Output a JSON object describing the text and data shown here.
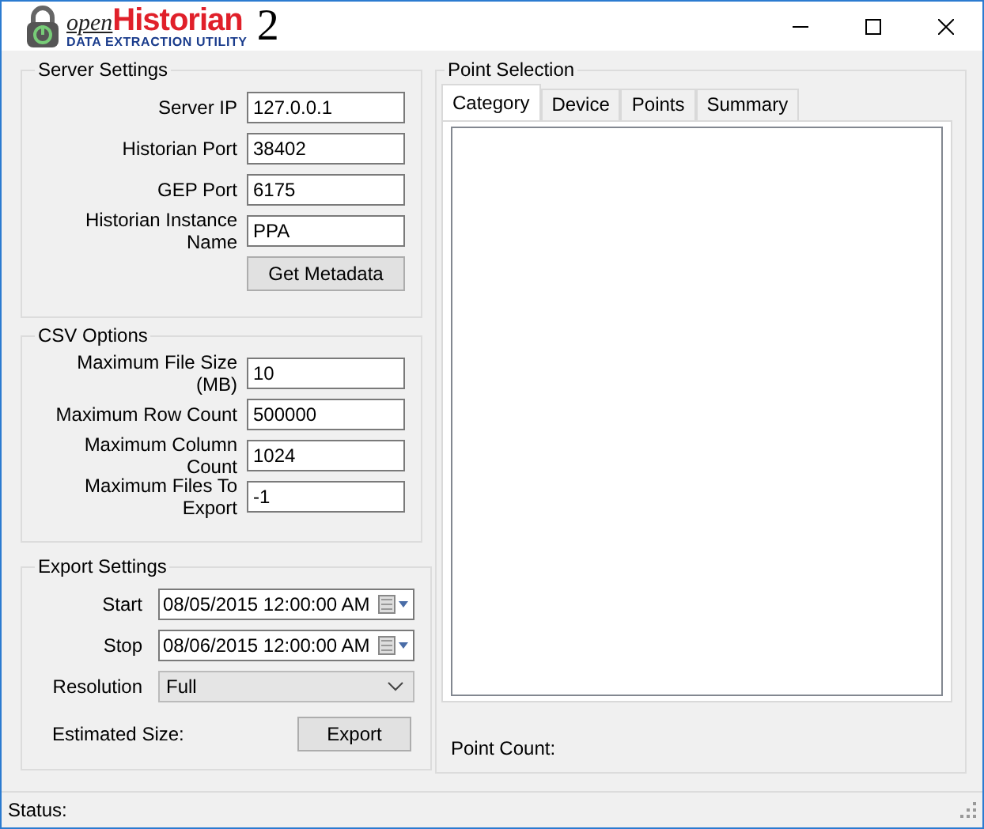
{
  "window": {
    "logo": {
      "prefix": "open",
      "name": "Historian",
      "subtitle": "DATA EXTRACTION UTILITY",
      "version": "2"
    }
  },
  "server_settings": {
    "title": "Server Settings",
    "fields": [
      {
        "label": "Server IP",
        "value": "127.0.0.1"
      },
      {
        "label": "Historian Port",
        "value": "38402"
      },
      {
        "label": "GEP Port",
        "value": "6175"
      },
      {
        "label": "Historian Instance Name",
        "value": "PPA"
      }
    ],
    "button": "Get Metadata"
  },
  "csv_options": {
    "title": "CSV Options",
    "fields": [
      {
        "label": "Maximum File Size (MB)",
        "value": "10"
      },
      {
        "label": "Maximum Row Count",
        "value": "500000"
      },
      {
        "label": "Maximum Column Count",
        "value": "1024"
      },
      {
        "label": "Maximum Files To Export",
        "value": "-1"
      }
    ]
  },
  "export_settings": {
    "title": "Export Settings",
    "start_label": "Start",
    "start": "08/05/2015 12:00:00 AM",
    "stop_label": "Stop",
    "stop": "08/06/2015 12:00:00 AM",
    "resolution_label": "Resolution",
    "resolution": "Full",
    "estimated_size_label": "Estimated Size:",
    "button": "Export"
  },
  "point_selection": {
    "title": "Point Selection",
    "tabs": [
      {
        "label": "Category",
        "selected": true
      },
      {
        "label": "Device",
        "selected": false
      },
      {
        "label": "Points",
        "selected": false
      },
      {
        "label": "Summary",
        "selected": false
      }
    ],
    "point_count_label": "Point Count:"
  },
  "status_bar": {
    "label": "Status:"
  }
}
